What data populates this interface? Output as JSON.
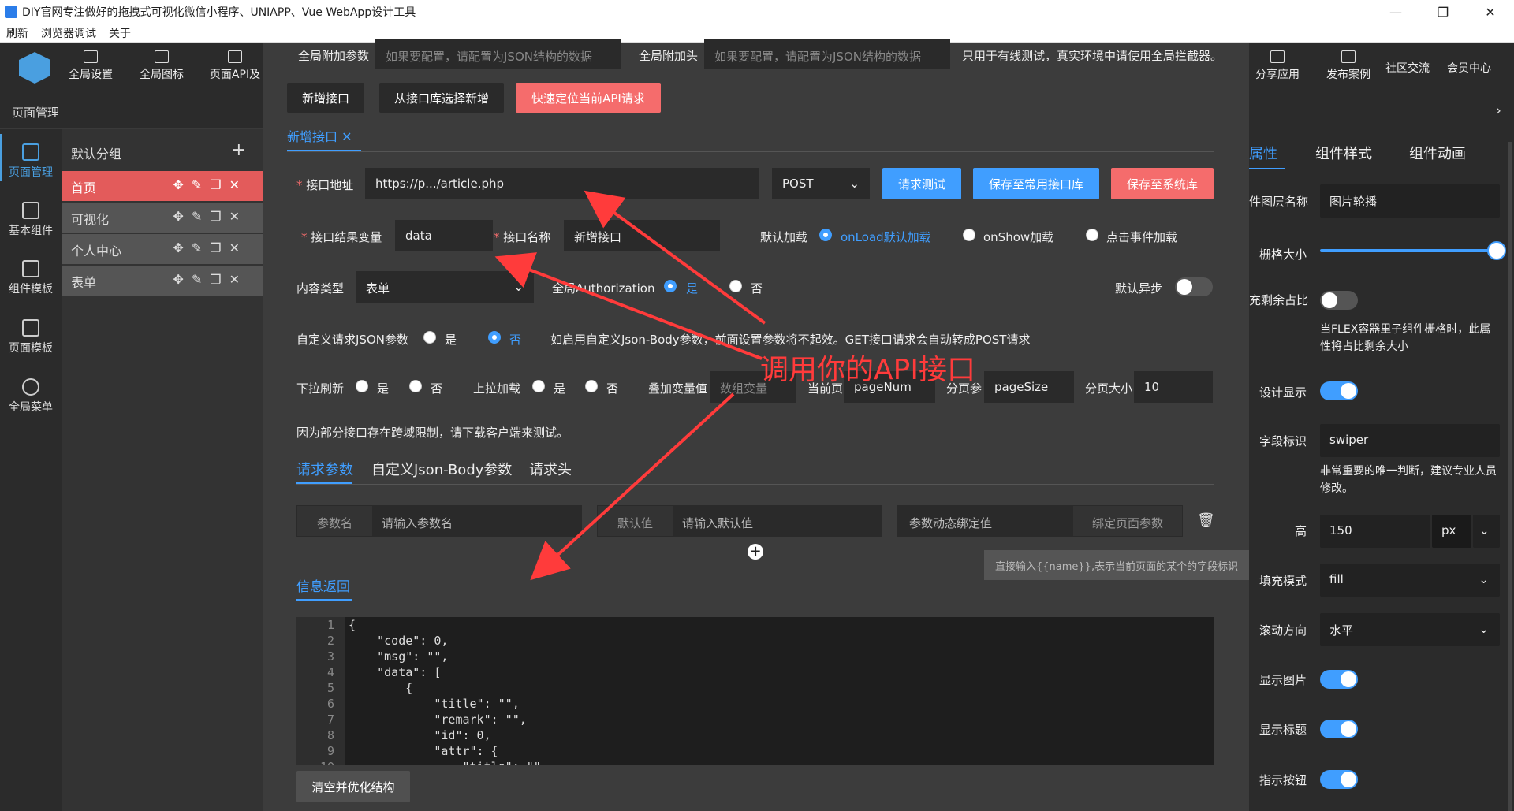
{
  "window": {
    "title": "DIY官网专注做好的拖拽式可视化微信小程序、UNIAPP、Vue WebApp设计工具",
    "minimize": "—",
    "maximize": "❐",
    "close": "✕"
  },
  "menu": [
    "刷新",
    "浏览器调试",
    "关于"
  ],
  "toolbar": {
    "left": [
      "全局设置",
      "全局图标",
      "页面API及"
    ],
    "right": [
      "分享应用",
      "发布案例",
      "社区交流",
      "会员中心"
    ]
  },
  "leftnav": [
    {
      "label": "页面管理",
      "icon": "layout-icon"
    },
    {
      "label": "基本组件",
      "icon": "puzzle-icon"
    },
    {
      "label": "组件模板",
      "icon": "template-icon"
    },
    {
      "label": "页面模板",
      "icon": "database-icon"
    },
    {
      "label": "全局菜单",
      "icon": "gear-icon"
    }
  ],
  "pages": {
    "header": "页面管理",
    "group": "默认分组",
    "items": [
      "首页",
      "可视化",
      "个人中心",
      "表单"
    ]
  },
  "modal": {
    "global_params_label": "全局附加参数",
    "global_params_ph": "如果要配置，请配置为JSON结构的数据",
    "global_header_label": "全局附加头",
    "global_header_ph": "如果要配置，请配置为JSON结构的数据",
    "global_note": "只用于有线测试，真实环境中请使用全局拦截器。",
    "btn_new": "新增接口",
    "btn_from_lib": "从接口库选择新增",
    "btn_locate": "快速定位当前API请求",
    "tab_active": "新增接口",
    "tab_close": "✕",
    "url_label": "接口地址",
    "url_value": "https://p.../article.php",
    "method": "POST",
    "btn_test": "请求测试",
    "btn_save_common": "保存至常用接口库",
    "btn_save_sys": "保存至系统库",
    "result_var_label": "接口结果变量",
    "result_var": "data",
    "name_label": "接口名称",
    "name_value": "新增接口",
    "default_load_label": "默认加载",
    "load_opts": [
      "onLoad默认加载",
      "onShow加载",
      "点击事件加载"
    ],
    "content_type_label": "内容类型",
    "content_type": "表单",
    "auth_label": "全局Authorization",
    "yes": "是",
    "no": "否",
    "async_label": "默认异步",
    "custom_json_label": "自定义请求JSON参数",
    "custom_json_note": "如启用自定义Json-Body参数，前面设置参数将不起效。GET接口请求会自动转成POST请求",
    "pulldown_label": "下拉刷新",
    "pullup_label": "上拉加载",
    "append_label": "叠加变量值",
    "append_ph": "数组变量",
    "curpage_label": "当前页",
    "curpage": "pageNum",
    "pagesize_label": "分页参",
    "pagesize": "pageSize",
    "size_label": "分页大小",
    "size": "10",
    "cors_note": "因为部分接口存在跨域限制，请下载客户端来测试。",
    "subtabs": [
      "请求参数",
      "自定义Json-Body参数",
      "请求头"
    ],
    "param_name": "参数名",
    "param_name_ph": "请输入参数名",
    "default_val": "默认值",
    "default_val_ph": "请输入默认值",
    "bind_label": "参数动态绑定值",
    "bind_btn": "绑定页面参数",
    "tooltip": "直接输入{{name}},表示当前页面的某个的字段标识",
    "return_tab": "信息返回",
    "clear_btn": "清空并优化结构",
    "code_lines": [
      "{",
      "    \"code\": 0,",
      "    \"msg\": \"\",",
      "    \"data\": [",
      "        {",
      "            \"title\": \"\",",
      "            \"remark\": \"\",",
      "            \"id\": 0,",
      "            \"attr\": {",
      "                \"title\": \"\""
    ]
  },
  "annotation": "调用你的API接口",
  "right": {
    "tabs": [
      "属性",
      "组件样式",
      "组件动画"
    ],
    "layer_label": "件图层名称",
    "layer_value": "图片轮播",
    "grid_label": "栅格大小",
    "grid_fraction": 1.0,
    "fill_rest_label": "充剩余占比",
    "fill_rest_note": "当FLEX容器里子组件栅格时，此属性将占比剩余大小",
    "design_show_label": "设计显示",
    "field_label": "字段标识",
    "field_value": "swiper",
    "field_note": "非常重要的唯一判断，建议专业人员修改。",
    "height_label": "高",
    "height_value": "150",
    "height_unit": "px",
    "fill_mode_label": "填充模式",
    "fill_mode": "fill",
    "scroll_label": "滚动方向",
    "scroll_value": "水平",
    "show_img_label": "显示图片",
    "show_title_label": "显示标题",
    "indicator_label": "指示按钮"
  },
  "colors": {
    "accent": "#409eff",
    "danger": "#f56c6c",
    "annotation": "#ff3b3b"
  }
}
